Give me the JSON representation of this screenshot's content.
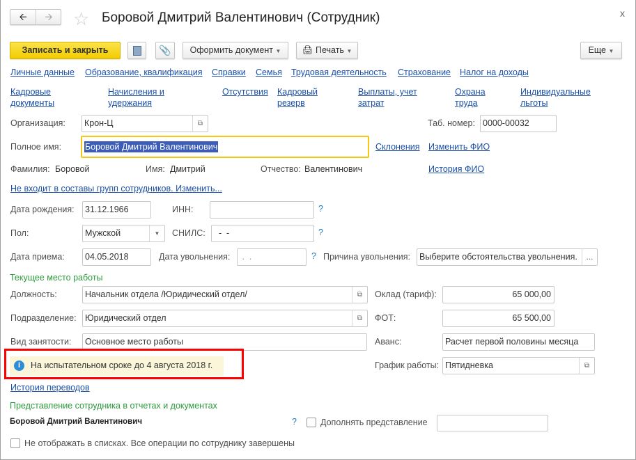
{
  "window": {
    "title": "Боровой Дмитрий Валентинович (Сотрудник)",
    "close": "x"
  },
  "toolbar": {
    "save_close": "Записать и закрыть",
    "make_doc": "Оформить документ",
    "print": "Печать",
    "more": "Еще"
  },
  "links_row1": [
    "Личные данные",
    "Образование, квалификация",
    "Справки",
    "Семья",
    "Трудовая деятельность",
    "Страхование",
    "Налог на доходы"
  ],
  "links_row2": [
    "Кадровые документы",
    "Начисления и удержания",
    "Отсутствия",
    "Кадровый резерв",
    "Выплаты, учет затрат",
    "Охрана труда",
    "Индивидуальные льготы"
  ],
  "form": {
    "org_label": "Организация:",
    "org_value": "Крон-Ц",
    "tab_label": "Таб. номер:",
    "tab_value": "0000-00032",
    "fullname_label": "Полное имя:",
    "fullname_value": "Боровой Дмитрий Валентинович",
    "declensions": "Склонения",
    "change_fio": "Изменить ФИО",
    "surname_label": "Фамилия:",
    "surname": "Боровой",
    "name_label": "Имя:",
    "name": "Дмитрий",
    "patronymic_label": "Отчество:",
    "patronymic": "Валентинович",
    "fio_history": "История ФИО",
    "groups_link": "Не входит в составы групп сотрудников. Изменить...",
    "birth_label": "Дата рождения:",
    "birth_value": "31.12.1966",
    "inn_label": "ИНН:",
    "inn_value": "",
    "sex_label": "Пол:",
    "sex_value": "Мужской",
    "snils_label": "СНИЛС:",
    "snils_value": "  -  -",
    "hire_label": "Дата приема:",
    "hire_value": "04.05.2018",
    "dismiss_label": "Дата увольнения:",
    "dismiss_value": " .  .",
    "reason_label": "Причина увольнения:",
    "reason_value": "Выберите обстоятельства увольнения.",
    "help": "?"
  },
  "work": {
    "section": "Текущее место работы",
    "position_label": "Должность:",
    "position_value": "Начальник отдела /Юридический отдел/",
    "salary_label": "Оклад (тариф):",
    "salary_value": "65 000,00",
    "dept_label": "Подразделение:",
    "dept_value": "Юридический отдел",
    "fot_label": "ФОТ:",
    "fot_value": "65 500,00",
    "employment_label": "Вид занятости:",
    "employment_value": "Основное место работы",
    "advance_label": "Аванс:",
    "advance_value": "Расчет первой половины месяца",
    "probation": "На испытательном сроке до 4 августа 2018 г.",
    "schedule_label": "График работы:",
    "schedule_value": "Пятидневка",
    "transfers_link": "История переводов"
  },
  "representation": {
    "section": "Представление сотрудника в отчетах и документах",
    "name": "Боровой Дмитрий Валентинович",
    "supplement_label": "Дополнять представление",
    "supplement_value": "",
    "hide_label": "Не отображать в списках. Все операции по сотруднику завершены"
  },
  "colors": {
    "accent_yellow": "#f5d20f",
    "link": "#1b4fa8",
    "section": "#2c9a3c",
    "highlight": "#ff0000"
  }
}
